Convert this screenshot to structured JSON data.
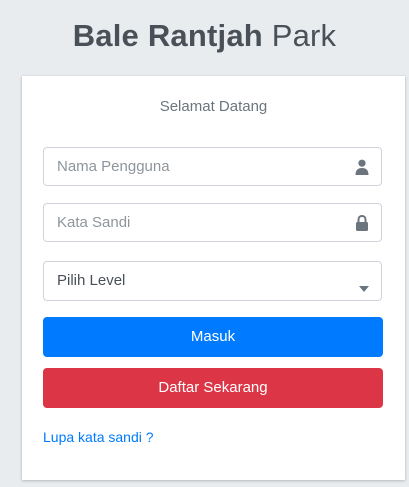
{
  "header": {
    "brand_bold": "Bale Rantjah",
    "brand_light": "Park"
  },
  "login": {
    "welcome": "Selamat Datang",
    "username_placeholder": "Nama Pengguna",
    "password_placeholder": "Kata Sandi",
    "level_select": {
      "selected": "Pilih Level"
    },
    "submit_label": "Masuk",
    "register_label": "Daftar Sekarang",
    "forgot_label": "Lupa kata sandi ?"
  },
  "icons": {
    "username": "user-icon",
    "password": "lock-icon",
    "select": "caret-down-icon"
  },
  "colors": {
    "primary": "#007bff",
    "danger": "#dc3545",
    "background": "#e9ecef"
  }
}
